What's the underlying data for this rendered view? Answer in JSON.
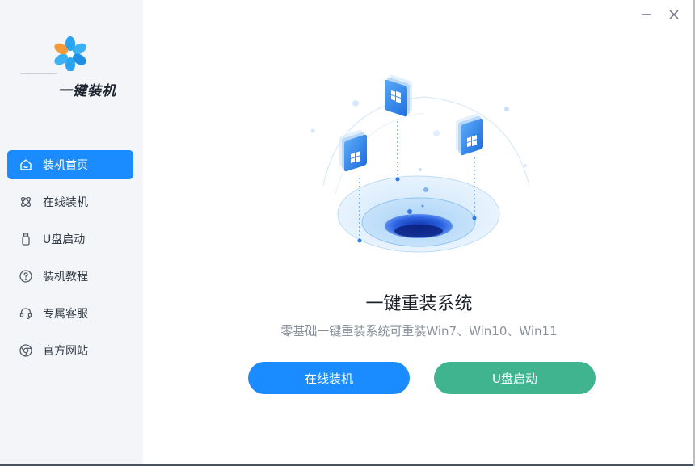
{
  "app": {
    "name": "一键装机"
  },
  "sidebar": {
    "items": [
      {
        "label": "装机首页",
        "icon": "home-icon"
      },
      {
        "label": "在线装机",
        "icon": "atom-icon"
      },
      {
        "label": "U盘启动",
        "icon": "usb-icon"
      },
      {
        "label": "装机教程",
        "icon": "help-icon"
      },
      {
        "label": "专属客服",
        "icon": "headset-icon"
      },
      {
        "label": "官方网站",
        "icon": "chrome-icon"
      }
    ],
    "active_index": 0
  },
  "window": {
    "minimize_icon": "minimize-icon",
    "close_icon": "close-icon"
  },
  "main": {
    "title": "一键重装系统",
    "subtitle": "零基础一键重装系统可重装Win7、Win10、Win11",
    "online_button": "在线装机",
    "usb_button": "U盘启动"
  },
  "colors": {
    "accent": "#1a8cff",
    "green": "#3fb48f",
    "sidebar_bg": "#f3f5f9"
  }
}
